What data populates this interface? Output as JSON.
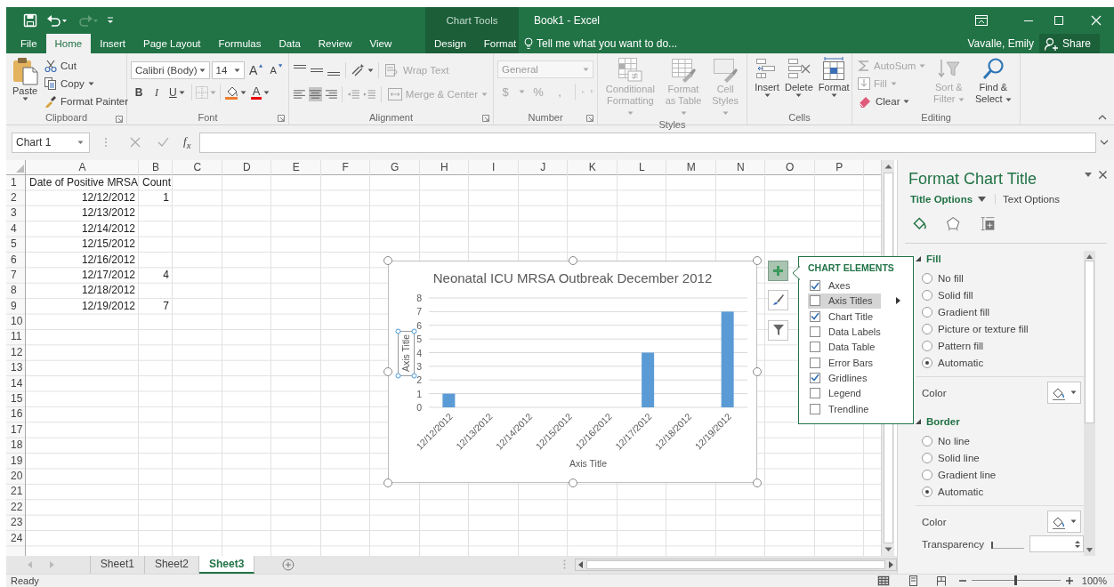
{
  "title_bar": {
    "context_group": "Chart Tools",
    "title": "Book1 - Excel"
  },
  "tabs": [
    {
      "label": "File",
      "selected": false,
      "kind": "main"
    },
    {
      "label": "Home",
      "selected": true,
      "kind": "main"
    },
    {
      "label": "Insert",
      "selected": false,
      "kind": "main"
    },
    {
      "label": "Page Layout",
      "selected": false,
      "kind": "main"
    },
    {
      "label": "Formulas",
      "selected": false,
      "kind": "main"
    },
    {
      "label": "Data",
      "selected": false,
      "kind": "main"
    },
    {
      "label": "Review",
      "selected": false,
      "kind": "main"
    },
    {
      "label": "View",
      "selected": false,
      "kind": "main"
    },
    {
      "label": "Design",
      "selected": false,
      "kind": "context"
    },
    {
      "label": "Format",
      "selected": false,
      "kind": "context"
    }
  ],
  "tell_me": {
    "placeholder": "Tell me what you want to do..."
  },
  "account": {
    "user": "Vavalle, Emily",
    "share": "Share"
  },
  "ribbon": {
    "clipboard": {
      "label": "Clipboard",
      "paste": "Paste",
      "cut": "Cut",
      "copy": "Copy",
      "format_painter": "Format Painter"
    },
    "font": {
      "label": "Font",
      "font_name": "Calibri (Body)",
      "font_size": "14",
      "grow": "A",
      "shrink": "A",
      "bold": "B",
      "italic": "I",
      "underline": "U",
      "font_color": "A"
    },
    "alignment": {
      "label": "Alignment",
      "horizontal": [
        {
          "selected": false
        },
        {
          "selected": true
        },
        {
          "selected": false
        }
      ],
      "wrap_text": {
        "label": "Wrap Text",
        "disabled": true
      },
      "merge": {
        "label": "Merge & Center",
        "disabled": true
      }
    },
    "number": {
      "label": "Number",
      "format": {
        "value": "General",
        "disabled": true
      },
      "symbols": [
        {
          "label": "$",
          "disabled": true
        },
        {
          "label": "%",
          "disabled": true
        },
        {
          "label": ",",
          "disabled": true
        }
      ]
    },
    "styles": {
      "label": "Styles",
      "commands": [
        {
          "label": "Conditional Formatting",
          "disabled": true
        },
        {
          "label": "Format as Table",
          "disabled": true
        },
        {
          "label": "Cell Styles",
          "disabled": true
        }
      ]
    },
    "cells": {
      "label": "Cells",
      "commands": [
        {
          "label": "Insert",
          "disabled": false
        },
        {
          "label": "Delete",
          "disabled": false
        },
        {
          "label": "Format",
          "disabled": false
        }
      ]
    },
    "editing": {
      "label": "Editing",
      "autosum": {
        "label": "AutoSum",
        "disabled": true
      },
      "fill": {
        "label": "Fill",
        "disabled": true
      },
      "clear": {
        "label": "Clear",
        "disabled": false
      },
      "sort_filter": {
        "label": "Sort & Filter",
        "disabled": true
      },
      "find_select": {
        "label": "Find & Select",
        "disabled": false
      }
    }
  },
  "formula_bar": {
    "name_box": "Chart 1",
    "function_label": "f$_{x}$"
  },
  "sheet": {
    "columns": [
      "A",
      "B",
      "C",
      "D",
      "E",
      "F",
      "G",
      "H",
      "I",
      "J",
      "K",
      "L",
      "M",
      "N",
      "O",
      "P"
    ],
    "rows": [
      {
        "number": "1",
        "cells": [
          {
            "text": "Date of Positive MRSA",
            "kind": "text"
          },
          {
            "text": "Count",
            "kind": "text"
          }
        ]
      },
      {
        "number": "2",
        "cells": [
          {
            "text": "12/12/2012",
            "kind": "number"
          },
          {
            "text": "1",
            "kind": "number"
          }
        ]
      },
      {
        "number": "3",
        "cells": [
          {
            "text": "12/13/2012",
            "kind": "number"
          }
        ]
      },
      {
        "number": "4",
        "cells": [
          {
            "text": "12/14/2012",
            "kind": "number"
          }
        ]
      },
      {
        "number": "5",
        "cells": [
          {
            "text": "12/15/2012",
            "kind": "number"
          }
        ]
      },
      {
        "number": "6",
        "cells": [
          {
            "text": "12/16/2012",
            "kind": "number"
          }
        ]
      },
      {
        "number": "7",
        "cells": [
          {
            "text": "12/17/2012",
            "kind": "number"
          },
          {
            "text": "4",
            "kind": "number"
          }
        ]
      },
      {
        "number": "8",
        "cells": [
          {
            "text": "12/18/2012",
            "kind": "number"
          }
        ]
      },
      {
        "number": "9",
        "cells": [
          {
            "text": "12/19/2012",
            "kind": "number"
          },
          {
            "text": "7",
            "kind": "number"
          }
        ]
      },
      {
        "number": "10"
      },
      {
        "number": "11"
      },
      {
        "number": "12"
      },
      {
        "number": "13"
      },
      {
        "number": "14"
      },
      {
        "number": "15"
      },
      {
        "number": "16"
      },
      {
        "number": "17"
      },
      {
        "number": "18"
      },
      {
        "number": "19"
      },
      {
        "number": "20"
      },
      {
        "number": "21"
      },
      {
        "number": "22"
      },
      {
        "number": "23"
      },
      {
        "number": "24"
      }
    ]
  },
  "chart": {
    "selected": true,
    "axis_title_selected": true,
    "chart_data": {
      "type": "bar",
      "title": "Neonatal ICU MRSA Outbreak December 2012",
      "xlabel": "Axis Title",
      "ylabel": "Axis Title",
      "categories": [
        "12/12/2012",
        "12/13/2012",
        "12/14/2012",
        "12/15/2012",
        "12/16/2012",
        "12/17/2012",
        "12/18/2012",
        "12/19/2012"
      ],
      "series": [
        {
          "color": "#5b9bd5",
          "values": [
            1,
            null,
            null,
            null,
            null,
            4,
            null,
            7
          ]
        }
      ],
      "ylim": [
        0,
        8
      ],
      "yticks": [
        0,
        1,
        2,
        3,
        4,
        5,
        6,
        7,
        8
      ],
      "grid": true
    }
  },
  "chart_elements": {
    "title": "CHART ELEMENTS",
    "items": [
      {
        "label": "Axes",
        "checked": true,
        "highlighted": false
      },
      {
        "label": "Axis Titles",
        "checked": false,
        "highlighted": true
      },
      {
        "label": "Chart Title",
        "checked": true,
        "highlighted": false
      },
      {
        "label": "Data Labels",
        "checked": false,
        "highlighted": false
      },
      {
        "label": "Data Table",
        "checked": false,
        "highlighted": false
      },
      {
        "label": "Error Bars",
        "checked": false,
        "highlighted": false
      },
      {
        "label": "Gridlines",
        "checked": true,
        "highlighted": false
      },
      {
        "label": "Legend",
        "checked": false,
        "highlighted": false
      },
      {
        "label": "Trendline",
        "checked": false,
        "highlighted": false
      }
    ]
  },
  "pane": {
    "title": "Format Chart Title",
    "tabs": [
      {
        "label": "Title Options",
        "selected": true
      },
      {
        "label": "Text Options",
        "selected": false
      }
    ],
    "categories": [
      {
        "selected": true
      },
      {
        "selected": false
      },
      {
        "selected": false
      }
    ],
    "sections": [
      {
        "title": "Fill",
        "expanded": true,
        "options": [
          {
            "label": "No fill",
            "selected": false
          },
          {
            "label": "Solid fill",
            "selected": false
          },
          {
            "label": "Gradient fill",
            "selected": false
          },
          {
            "label": "Picture or texture fill",
            "selected": false
          },
          {
            "label": "Pattern fill",
            "selected": false
          },
          {
            "label": "Automatic",
            "selected": true
          }
        ],
        "color_label": "Color"
      },
      {
        "title": "Border",
        "expanded": true,
        "options": [
          {
            "label": "No line",
            "selected": false
          },
          {
            "label": "Solid line",
            "selected": false
          },
          {
            "label": "Gradient line",
            "selected": false
          },
          {
            "label": "Automatic",
            "selected": true
          }
        ],
        "color_label": "Color",
        "transparency": {
          "label": "Transparency",
          "level": 0
        }
      }
    ]
  },
  "sheet_tabs": [
    {
      "label": "Sheet1",
      "selected": false
    },
    {
      "label": "Sheet2",
      "selected": false
    },
    {
      "label": "Sheet3",
      "selected": true
    }
  ],
  "status_bar": {
    "status": "Ready",
    "zoom": "100%",
    "level": 0.5
  }
}
